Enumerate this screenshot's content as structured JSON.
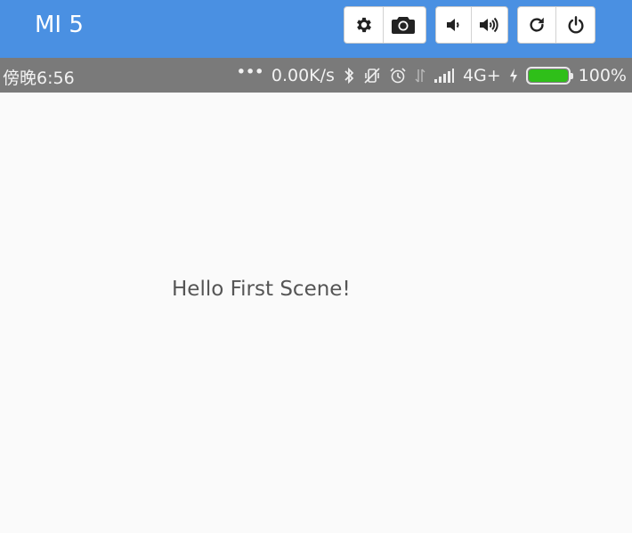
{
  "toolbar": {
    "device_name": "MI 5",
    "groups": [
      {
        "buttons": [
          {
            "icon": "gear-icon"
          },
          {
            "icon": "camera-icon"
          }
        ]
      },
      {
        "buttons": [
          {
            "icon": "volume-down-icon"
          },
          {
            "icon": "volume-up-icon"
          }
        ]
      },
      {
        "buttons": [
          {
            "icon": "rotate-icon"
          },
          {
            "icon": "power-icon"
          }
        ]
      }
    ],
    "accent_color": "#4a90e2"
  },
  "status_bar": {
    "time": "傍晚6:56",
    "dots": "•••",
    "network_speed": "0.00K/s",
    "network_type": "4G+",
    "battery_percent_text": "100%",
    "battery_level": 1.0,
    "battery_color": "#2fbf19",
    "icons": [
      "bluetooth-icon",
      "vibrate-off-icon",
      "alarm-icon",
      "data-transfer-icon",
      "signal-icon",
      "charging-icon",
      "battery-icon"
    ]
  },
  "screen": {
    "message": "Hello First Scene!"
  }
}
